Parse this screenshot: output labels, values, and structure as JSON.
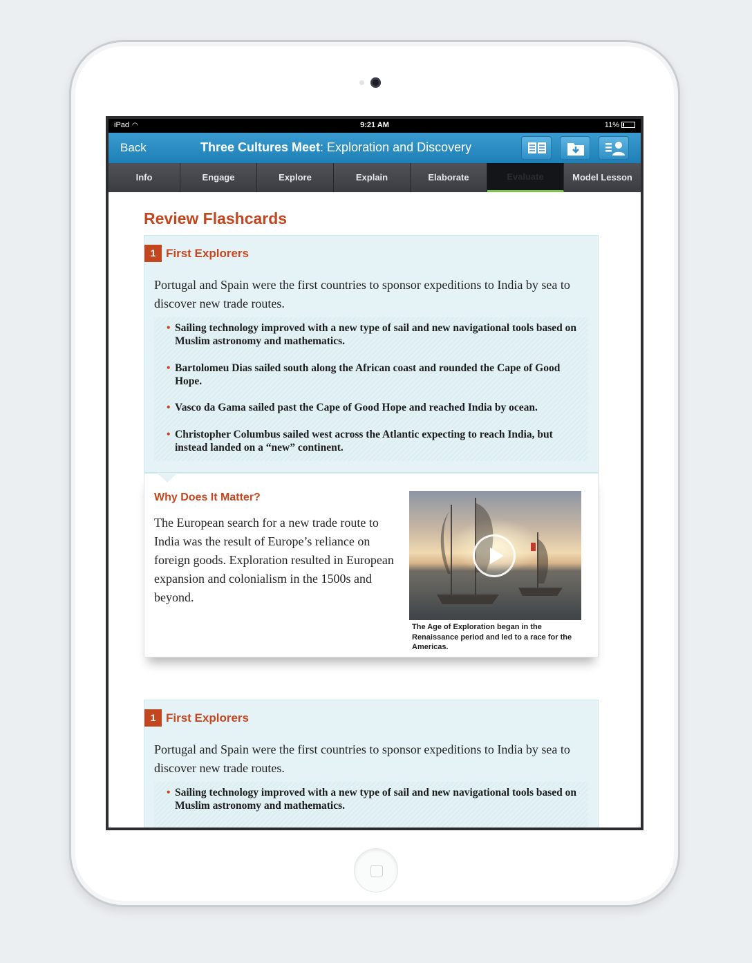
{
  "status_bar": {
    "device": "iPad",
    "time": "9:21 AM",
    "battery": "11%"
  },
  "app_bar": {
    "back_label": "Back",
    "title_bold": "Three Cultures Meet",
    "title_rest": ": Exploration and Discovery",
    "buttons": [
      "book-icon",
      "download-icon",
      "profile-icon"
    ]
  },
  "tabs": [
    "Info",
    "Engage",
    "Explore",
    "Explain",
    "Elaborate",
    "Evaluate",
    "Model Lesson"
  ],
  "active_tab": "Evaluate",
  "colors": {
    "accent": "#c4461f",
    "app_bar": "#1e7fb6",
    "card_bg": "#e6f3f6",
    "active_tab_indicator": "#7fc24a"
  },
  "page_heading": "Review Flashcards",
  "cards": [
    {
      "number": "1",
      "title": "First Explorers",
      "intro": "Portugal and Spain were the first countries to sponsor expeditions to India by sea to discover new trade routes.",
      "bullets": [
        "Sailing technology improved with a new type of sail and new navigational tools based on Muslim astronomy and mathematics.",
        "Bartolomeu Dias sailed south along the African coast and rounded the Cape of Good Hope.",
        "Vasco da Gama sailed past the Cape of Good Hope and reached India by ocean.",
        "Christopher Columbus sailed west across the Atlantic expecting to reach India, but instead landed on a “new” continent."
      ],
      "why_title": "Why Does It Matter?",
      "why_text": "The European search for a new trade route to India was the result of Europe’s reliance on foreign goods. Exploration resulted in European expansion and colonialism in the 1500s and beyond.",
      "video_caption": "The Age of Exploration began in the Renaissance period and led to a race for the Americas."
    },
    {
      "number": "1",
      "title": "First Explorers",
      "intro": "Portugal and Spain were the first countries to sponsor expeditions to India by sea to discover new trade routes.",
      "bullets": [
        "Sailing technology improved with a new type of sail and new navigational tools based on Muslim astronomy and mathematics."
      ]
    }
  ]
}
